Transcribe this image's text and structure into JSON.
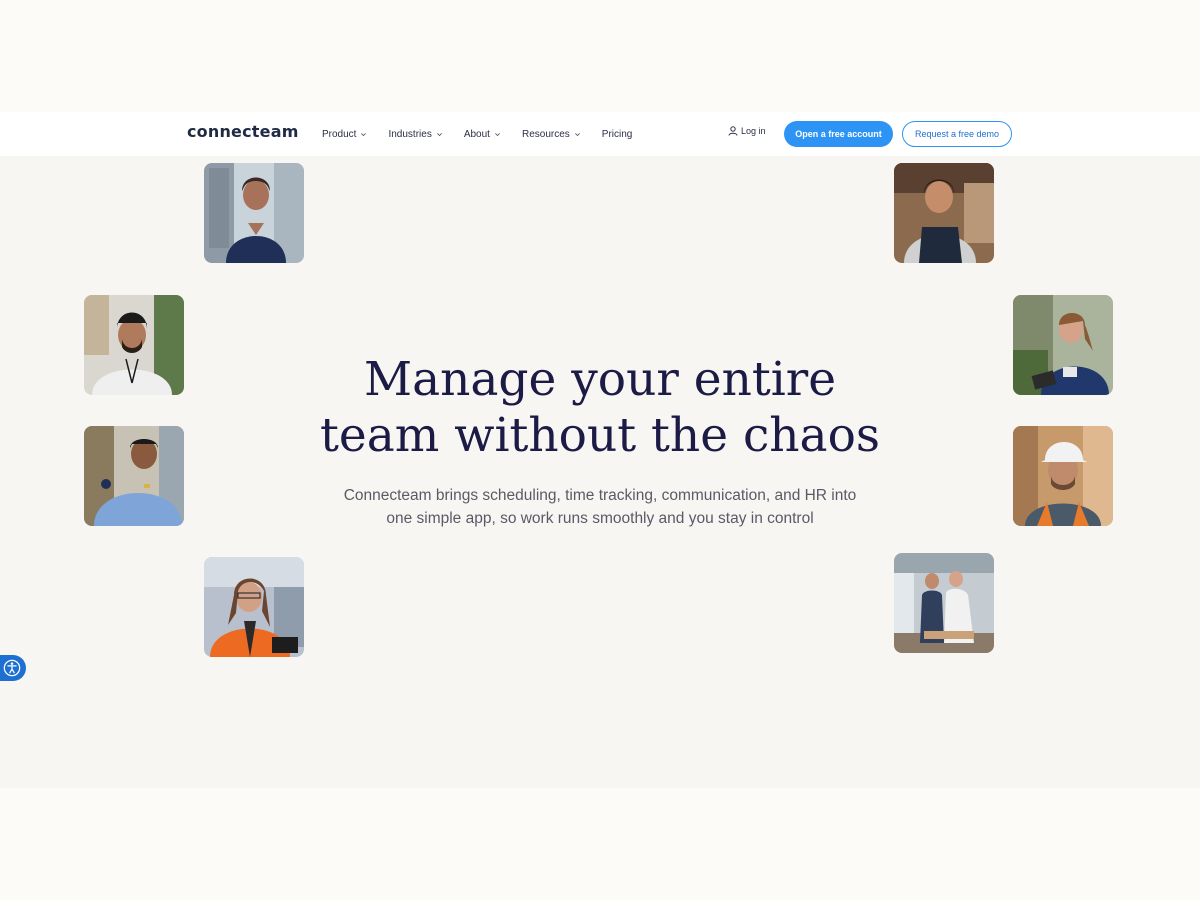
{
  "brand": {
    "logo_text": "connecteam"
  },
  "nav": {
    "items": [
      {
        "label": "Product",
        "has_dropdown": true
      },
      {
        "label": "Industries",
        "has_dropdown": true
      },
      {
        "label": "About",
        "has_dropdown": true
      },
      {
        "label": "Resources",
        "has_dropdown": true
      },
      {
        "label": "Pricing",
        "has_dropdown": false
      }
    ],
    "login_label": "Log in",
    "primary_cta": "Open a free account",
    "secondary_cta": "Request a free demo"
  },
  "hero": {
    "headline_line1": "Manage your entire",
    "headline_line2": "team without the chaos",
    "subtitle_line1": "Connecteam brings scheduling, time tracking, communication, and HR into",
    "subtitle_line2": "one simple app, so work runs smoothly and you stay in control"
  },
  "colors": {
    "accent": "#2d94f5",
    "headline": "#1c1b46",
    "hero_background": "#f8f6f3",
    "accessibility_button": "#1d6fd1"
  },
  "photos": [
    {
      "name": "photo-nurse-smiling"
    },
    {
      "name": "photo-chef-apron"
    },
    {
      "name": "photo-man-beanie-lanyard"
    },
    {
      "name": "photo-nurse-tablet"
    },
    {
      "name": "photo-security-guard"
    },
    {
      "name": "photo-construction-worker-hardhat"
    },
    {
      "name": "photo-worker-orange-jacket"
    },
    {
      "name": "photo-two-men-office"
    }
  ]
}
